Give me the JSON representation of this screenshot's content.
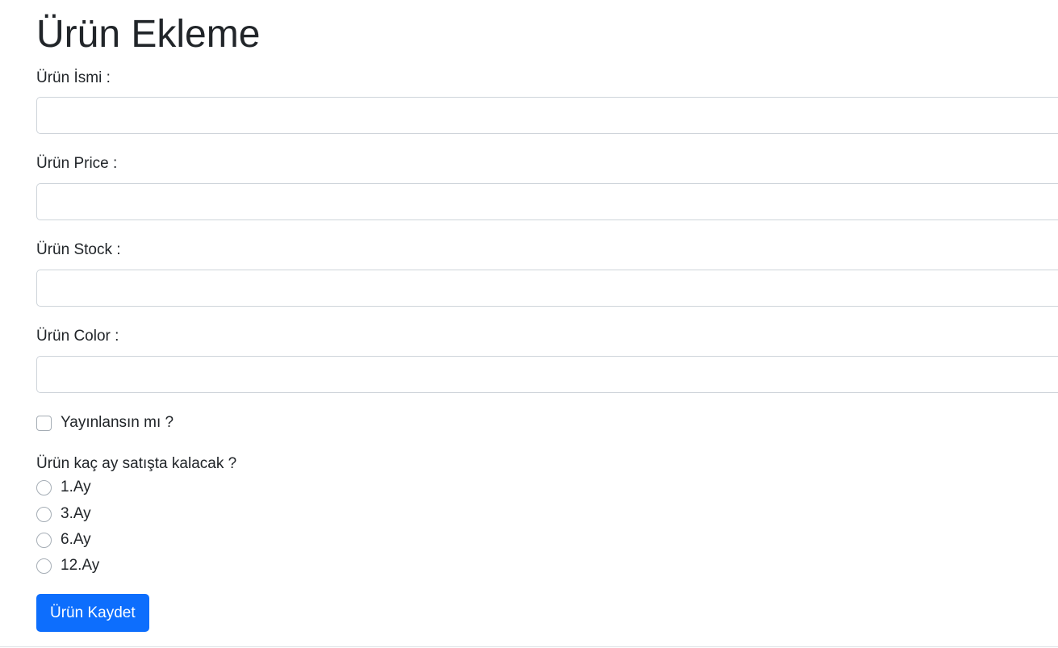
{
  "page": {
    "title": "Ürün Ekleme"
  },
  "form": {
    "fields": [
      {
        "label": "Ürün İsmi :",
        "value": ""
      },
      {
        "label": "Ürün Price :",
        "value": ""
      },
      {
        "label": "Ürün Stock :",
        "value": ""
      },
      {
        "label": "Ürün Color :",
        "value": ""
      }
    ],
    "publish": {
      "label": "Yayınlansın mı ?",
      "checked": false
    },
    "duration": {
      "question": "Ürün kaç ay satışta kalacak ?",
      "options": [
        "1.Ay",
        "3.Ay",
        "6.Ay",
        "12.Ay"
      ]
    },
    "submit_label": "Ürün Kaydet"
  },
  "colors": {
    "primary": "#0d6efd",
    "text": "#212529",
    "border": "#ced4da"
  }
}
